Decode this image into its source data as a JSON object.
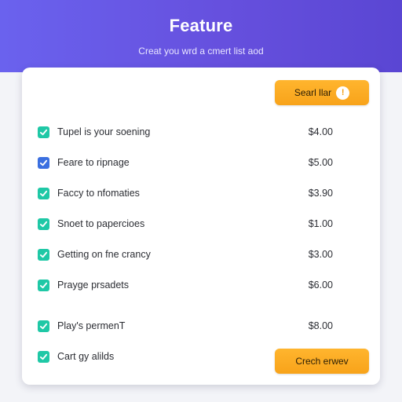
{
  "header": {
    "title": "Feature",
    "subtitle": "Creat you wrd a cmert list aod"
  },
  "actions": {
    "top_button": {
      "label": "Searl llar",
      "icon": "exclamation-icon"
    },
    "bottom_button": {
      "label": "Crech erwev"
    }
  },
  "items": [
    {
      "label": "Tupel is your soening",
      "price": "$4.00",
      "checked": true,
      "color": "#1fc8a6"
    },
    {
      "label": "Feare to ripnage",
      "price": "$5.00",
      "checked": true,
      "color": "#3b6fe0"
    },
    {
      "label": "Faccy to nfomaties",
      "price": "$3.90",
      "checked": true,
      "color": "#1fc8a6"
    },
    {
      "label": "Snoet to papercioes",
      "price": "$1.00",
      "checked": true,
      "color": "#1fc8a6"
    },
    {
      "label": "Getting on fne crancy",
      "price": "$3.00",
      "checked": true,
      "color": "#1fc8a6"
    },
    {
      "label": "Prayge prsadets",
      "price": "$6.00",
      "checked": true,
      "color": "#1fc8a6"
    },
    {
      "label": "Play's permenT",
      "price": "$8.00",
      "checked": true,
      "color": "#1fc8a6"
    },
    {
      "label": "Cart gy alilds",
      "price": "",
      "checked": true,
      "color": "#1fc8a6"
    }
  ]
}
